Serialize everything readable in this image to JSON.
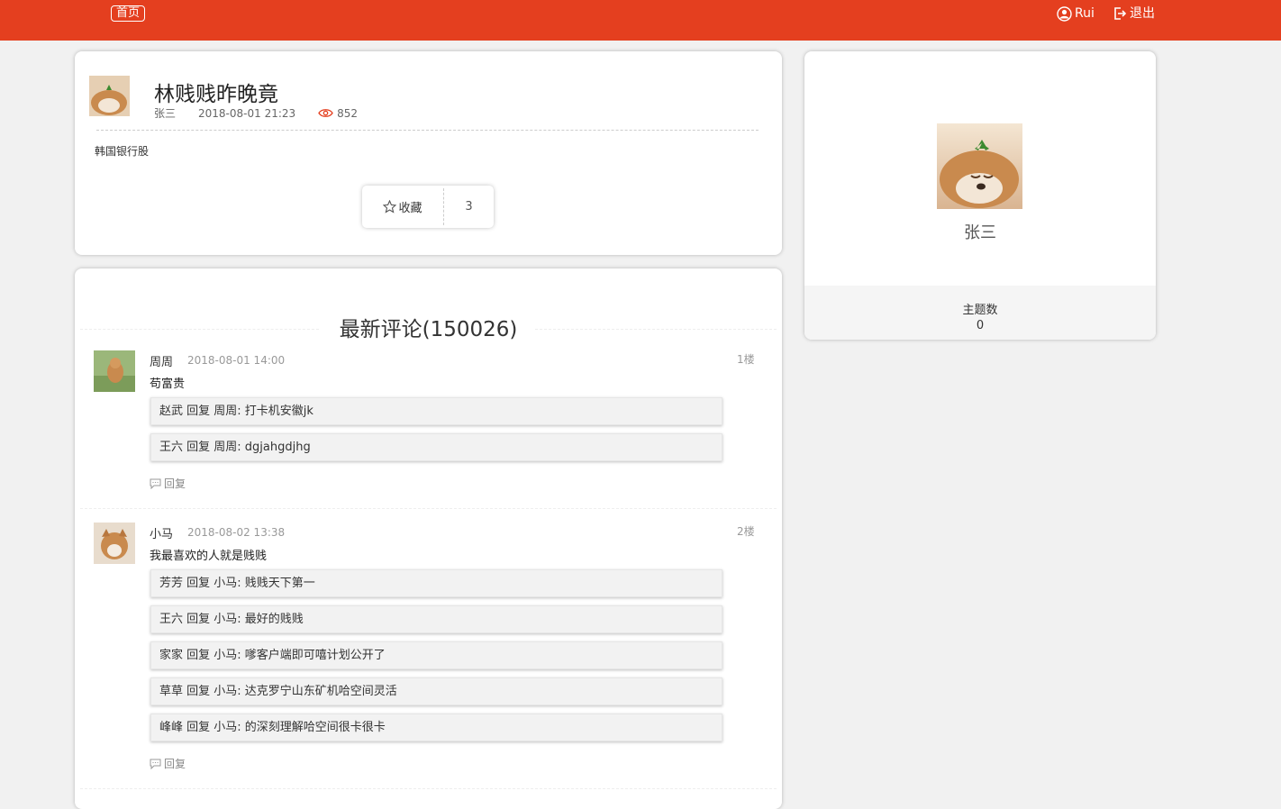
{
  "nav": {
    "home_label": "首页",
    "user_name": "Rui",
    "logout_label": "退出"
  },
  "post": {
    "title": "林贱贱昨晚竟",
    "author": "张三",
    "datetime": "2018-08-01 21:23",
    "views": "852",
    "body": "韩国银行股",
    "favorite_label": "收藏",
    "favorite_count": "3"
  },
  "comments_section": {
    "title": "最新评论(150026)",
    "reply_label": "回复",
    "comments": [
      {
        "name": "周周",
        "time": "2018-08-01 14:00",
        "floor": "1楼",
        "text": "苟富贵",
        "replies": [
          "赵武 回复 周周: 打卡机安徽jk",
          "王六 回复 周周: dgjahgdjhg"
        ]
      },
      {
        "name": "小马",
        "time": "2018-08-02 13:38",
        "floor": "2楼",
        "text": "我最喜欢的人就是贱贱",
        "replies": [
          "芳芳 回复 小马: 贱贱天下第一",
          "王六 回复 小马: 最好的贱贱",
          "家家 回复 小马: 嗲客户端即可嘻计划公开了",
          "草草 回复 小马: 达克罗宁山东矿机哈空间灵活",
          "峰峰 回复 小马: 的深刻理解哈空间很卡很卡"
        ]
      }
    ]
  },
  "profile": {
    "name": "张三",
    "stat_label": "主题数",
    "stat_value": "0"
  },
  "colors": {
    "brand": "#e43f1f",
    "background": "#f1f1f1",
    "view_icon": "#e43f1f"
  }
}
